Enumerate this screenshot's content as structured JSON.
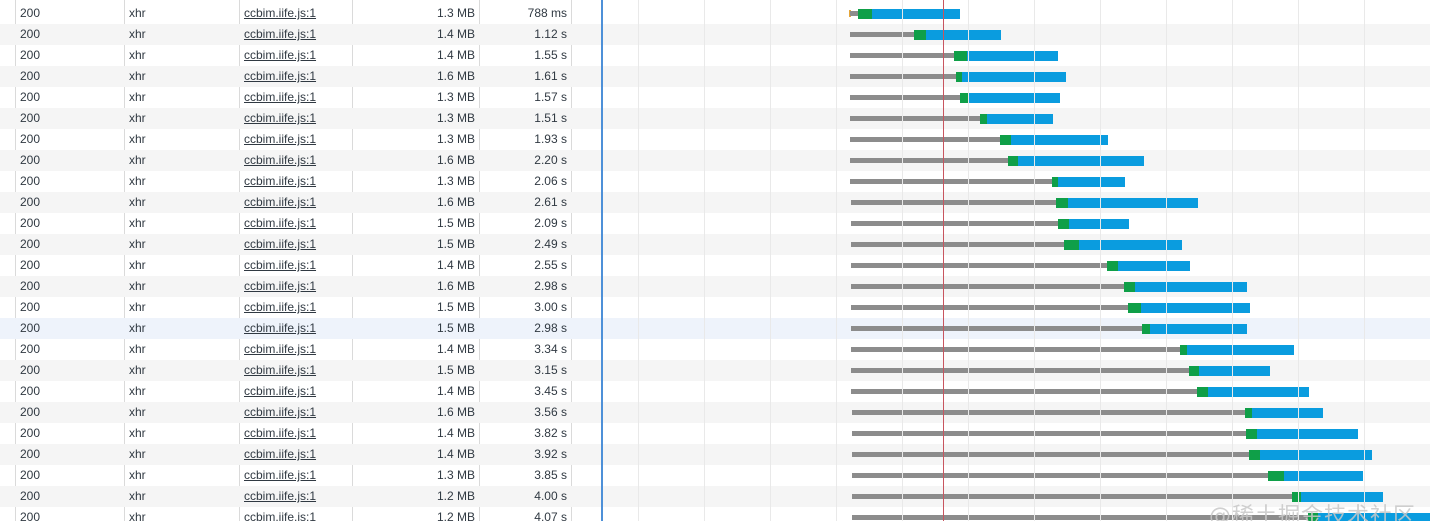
{
  "rows": [
    {
      "status": "200",
      "type": "xhr",
      "initiator": "ccbim.iife.js:1",
      "size": "1.3 MB",
      "time": "788 ms"
    },
    {
      "status": "200",
      "type": "xhr",
      "initiator": "ccbim.iife.js:1",
      "size": "1.4 MB",
      "time": "1.12 s"
    },
    {
      "status": "200",
      "type": "xhr",
      "initiator": "ccbim.iife.js:1",
      "size": "1.4 MB",
      "time": "1.55 s"
    },
    {
      "status": "200",
      "type": "xhr",
      "initiator": "ccbim.iife.js:1",
      "size": "1.6 MB",
      "time": "1.61 s"
    },
    {
      "status": "200",
      "type": "xhr",
      "initiator": "ccbim.iife.js:1",
      "size": "1.3 MB",
      "time": "1.57 s"
    },
    {
      "status": "200",
      "type": "xhr",
      "initiator": "ccbim.iife.js:1",
      "size": "1.3 MB",
      "time": "1.51 s"
    },
    {
      "status": "200",
      "type": "xhr",
      "initiator": "ccbim.iife.js:1",
      "size": "1.3 MB",
      "time": "1.93 s"
    },
    {
      "status": "200",
      "type": "xhr",
      "initiator": "ccbim.iife.js:1",
      "size": "1.6 MB",
      "time": "2.20 s"
    },
    {
      "status": "200",
      "type": "xhr",
      "initiator": "ccbim.iife.js:1",
      "size": "1.3 MB",
      "time": "2.06 s"
    },
    {
      "status": "200",
      "type": "xhr",
      "initiator": "ccbim.iife.js:1",
      "size": "1.6 MB",
      "time": "2.61 s"
    },
    {
      "status": "200",
      "type": "xhr",
      "initiator": "ccbim.iife.js:1",
      "size": "1.5 MB",
      "time": "2.09 s"
    },
    {
      "status": "200",
      "type": "xhr",
      "initiator": "ccbim.iife.js:1",
      "size": "1.5 MB",
      "time": "2.49 s"
    },
    {
      "status": "200",
      "type": "xhr",
      "initiator": "ccbim.iife.js:1",
      "size": "1.4 MB",
      "time": "2.55 s"
    },
    {
      "status": "200",
      "type": "xhr",
      "initiator": "ccbim.iife.js:1",
      "size": "1.6 MB",
      "time": "2.98 s"
    },
    {
      "status": "200",
      "type": "xhr",
      "initiator": "ccbim.iife.js:1",
      "size": "1.5 MB",
      "time": "3.00 s"
    },
    {
      "status": "200",
      "type": "xhr",
      "initiator": "ccbim.iife.js:1",
      "size": "1.5 MB",
      "time": "2.98 s"
    },
    {
      "status": "200",
      "type": "xhr",
      "initiator": "ccbim.iife.js:1",
      "size": "1.4 MB",
      "time": "3.34 s"
    },
    {
      "status": "200",
      "type": "xhr",
      "initiator": "ccbim.iife.js:1",
      "size": "1.5 MB",
      "time": "3.15 s"
    },
    {
      "status": "200",
      "type": "xhr",
      "initiator": "ccbim.iife.js:1",
      "size": "1.4 MB",
      "time": "3.45 s"
    },
    {
      "status": "200",
      "type": "xhr",
      "initiator": "ccbim.iife.js:1",
      "size": "1.6 MB",
      "time": "3.56 s"
    },
    {
      "status": "200",
      "type": "xhr",
      "initiator": "ccbim.iife.js:1",
      "size": "1.4 MB",
      "time": "3.82 s"
    },
    {
      "status": "200",
      "type": "xhr",
      "initiator": "ccbim.iife.js:1",
      "size": "1.4 MB",
      "time": "3.92 s"
    },
    {
      "status": "200",
      "type": "xhr",
      "initiator": "ccbim.iife.js:1",
      "size": "1.3 MB",
      "time": "3.85 s"
    },
    {
      "status": "200",
      "type": "xhr",
      "initiator": "ccbim.iife.js:1",
      "size": "1.2 MB",
      "time": "4.00 s"
    },
    {
      "status": "200",
      "type": "xhr",
      "initiator": "ccbim.iife.js:1",
      "size": "1.2 MB",
      "time": "4.07 s"
    }
  ],
  "selected_row": 15,
  "watermark": "@稀土掘金技术社区",
  "colors": {
    "waiting": "#8c8c8c",
    "ttfb": "#0f9f48",
    "download": "#0a9cdf",
    "dom_content_loaded_line": "#4d90d8",
    "load_line": "#c8555f"
  }
}
